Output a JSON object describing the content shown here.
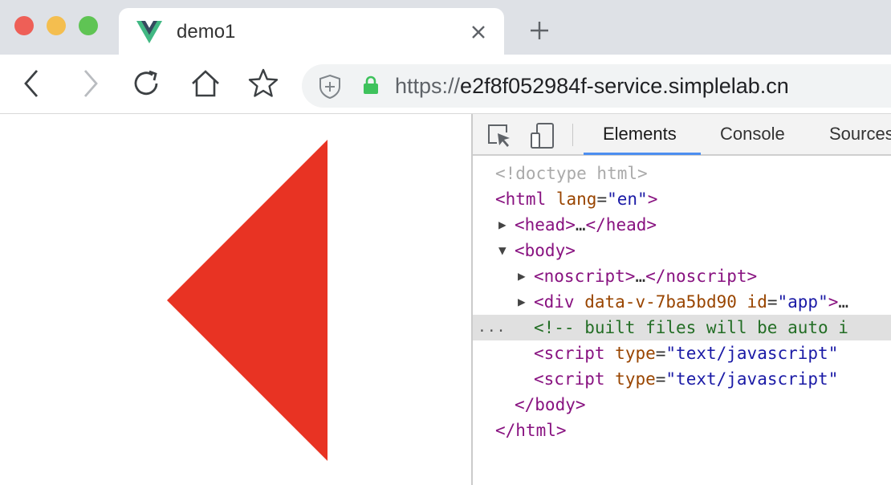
{
  "tab": {
    "title": "demo1"
  },
  "toolbar": {
    "url_scheme": "https://",
    "url_host": "e2f8f052984f-service.simplelab.cn"
  },
  "devtools": {
    "tabs": [
      "Elements",
      "Console",
      "Sources"
    ],
    "active_tab": "Elements",
    "tree": {
      "doctype": "<!doctype html>",
      "html_open_tag": "<html",
      "html_lang_attr": "lang",
      "html_lang_eq": "=",
      "html_lang_value": "\"en\"",
      "html_open_close": ">",
      "head_open": "<head>",
      "head_ellipsis": "…",
      "head_close": "</head>",
      "body_open": "<body>",
      "noscript_open": "<noscript>",
      "noscript_ellipsis": "…",
      "noscript_close": "</noscript>",
      "div_open_tag": "<div",
      "div_attr1": "data-v-7ba5bd90",
      "div_attr2": "id",
      "div_eq": "=",
      "div_attr2_value": "\"app\"",
      "div_open_close": ">",
      "div_ellipsis": "…",
      "selected_dots": "...",
      "comment": "<!-- built files will be auto i",
      "script1_tag": "<script",
      "script1_attr": "type",
      "script1_eq": "=",
      "script1_value": "\"text/javascript\"",
      "script2_tag": "<script",
      "script2_attr": "type",
      "script2_eq": "=",
      "script2_value": "\"text/javascript\"",
      "body_close": "</body>",
      "html_close": "</html>"
    }
  },
  "page": {
    "shape_color": "#e83323"
  }
}
